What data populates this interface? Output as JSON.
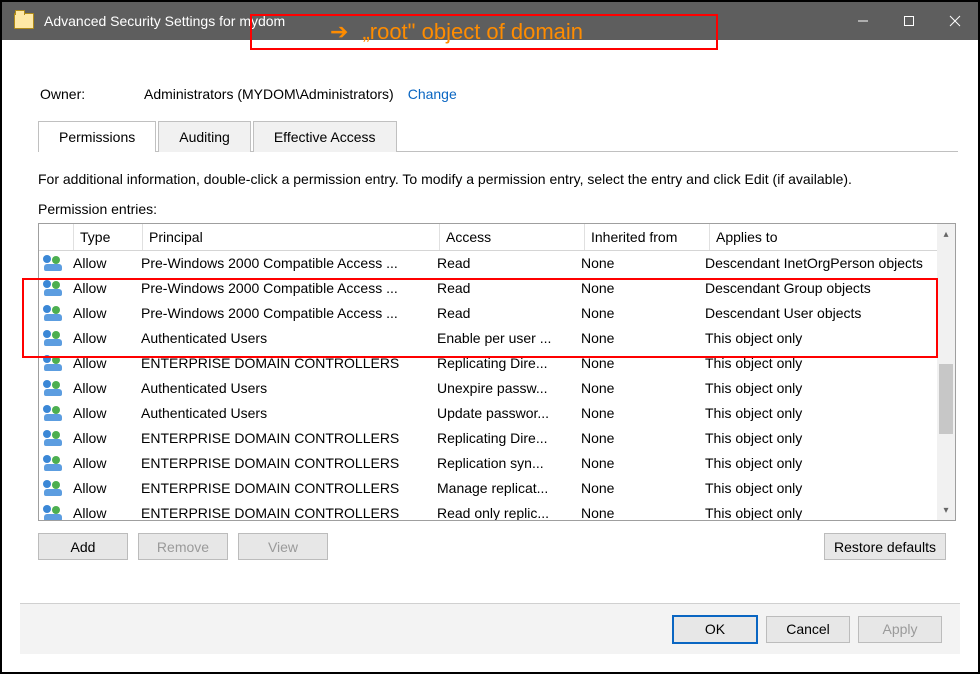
{
  "annotation": "„root\" object of domain",
  "window": {
    "title": "Advanced Security Settings for mydom"
  },
  "owner": {
    "label": "Owner:",
    "value": "Administrators (MYDOM\\Administrators)",
    "change": "Change"
  },
  "tabs": {
    "permissions": "Permissions",
    "auditing": "Auditing",
    "effective": "Effective Access"
  },
  "hint": "For additional information, double-click a permission entry. To modify a permission entry, select the entry and click Edit (if available).",
  "entries_label": "Permission entries:",
  "columns": {
    "type": "Type",
    "principal": "Principal",
    "access": "Access",
    "inherited": "Inherited from",
    "applies": "Applies to"
  },
  "rows": [
    {
      "type": "Allow",
      "principal": "Pre-Windows 2000 Compatible Access ...",
      "access": "Read",
      "inherited": "None",
      "applies": "Descendant InetOrgPerson objects"
    },
    {
      "type": "Allow",
      "principal": "Pre-Windows 2000 Compatible Access ...",
      "access": "Read",
      "inherited": "None",
      "applies": "Descendant Group objects"
    },
    {
      "type": "Allow",
      "principal": "Pre-Windows 2000 Compatible Access ...",
      "access": "Read",
      "inherited": "None",
      "applies": "Descendant User objects"
    },
    {
      "type": "Allow",
      "principal": "Authenticated Users",
      "access": "Enable per user ...",
      "inherited": "None",
      "applies": "This object only"
    },
    {
      "type": "Allow",
      "principal": "ENTERPRISE DOMAIN CONTROLLERS",
      "access": "Replicating Dire...",
      "inherited": "None",
      "applies": "This object only"
    },
    {
      "type": "Allow",
      "principal": "Authenticated Users",
      "access": "Unexpire passw...",
      "inherited": "None",
      "applies": "This object only"
    },
    {
      "type": "Allow",
      "principal": "Authenticated Users",
      "access": "Update passwor...",
      "inherited": "None",
      "applies": "This object only"
    },
    {
      "type": "Allow",
      "principal": "ENTERPRISE DOMAIN CONTROLLERS",
      "access": "Replicating Dire...",
      "inherited": "None",
      "applies": "This object only"
    },
    {
      "type": "Allow",
      "principal": "ENTERPRISE DOMAIN CONTROLLERS",
      "access": "Replication syn...",
      "inherited": "None",
      "applies": "This object only"
    },
    {
      "type": "Allow",
      "principal": "ENTERPRISE DOMAIN CONTROLLERS",
      "access": "Manage replicat...",
      "inherited": "None",
      "applies": "This object only"
    },
    {
      "type": "Allow",
      "principal": "ENTERPRISE DOMAIN CONTROLLERS",
      "access": "Read only replic...",
      "inherited": "None",
      "applies": "This object only"
    }
  ],
  "buttons": {
    "add": "Add",
    "remove": "Remove",
    "view": "View",
    "restore": "Restore defaults",
    "ok": "OK",
    "cancel": "Cancel",
    "apply": "Apply"
  }
}
